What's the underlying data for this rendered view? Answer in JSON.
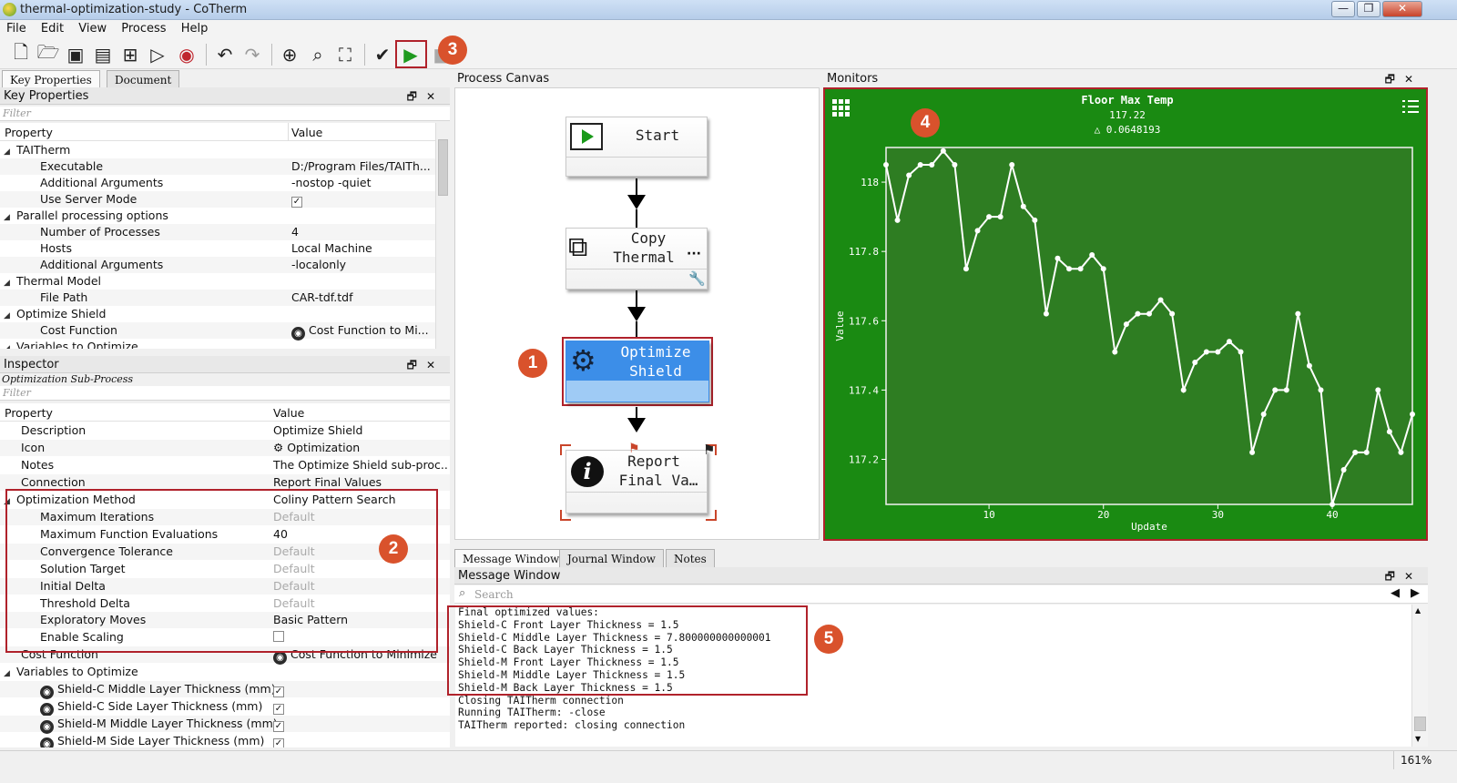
{
  "window": {
    "title": "thermal-optimization-study - CoTherm"
  },
  "menu": [
    "File",
    "Edit",
    "View",
    "Process",
    "Help"
  ],
  "colors": {
    "accent_red": "#b0222b",
    "badge": "#d9522c",
    "monitor_bg": "#1a8a12",
    "selected_node": "#3c8ee8"
  },
  "left_tabs": [
    "Key Properties",
    "Document"
  ],
  "key_properties": {
    "title": "Key Properties",
    "filter_placeholder": "Filter",
    "headers": {
      "property": "Property",
      "value": "Value"
    },
    "rows": [
      {
        "label": "TAITherm",
        "value": "",
        "level": 0,
        "group": true
      },
      {
        "label": "Executable",
        "value": "D:/Program Files/TAITh...",
        "level": 1
      },
      {
        "label": "Additional Arguments",
        "value": "-nostop -quiet",
        "level": 1
      },
      {
        "label": "Use Server Mode",
        "value": "✓",
        "level": 1,
        "checkbox": true
      },
      {
        "label": "Parallel processing options",
        "value": "",
        "level": 0,
        "group": true
      },
      {
        "label": "Number of Processes",
        "value": "4",
        "level": 1
      },
      {
        "label": "Hosts",
        "value": "Local Machine",
        "level": 1
      },
      {
        "label": "Additional Arguments",
        "value": "-localonly",
        "level": 1
      },
      {
        "label": "Thermal Model",
        "value": "",
        "level": 0,
        "group": true
      },
      {
        "label": "File Path",
        "value": "CAR-tdf.tdf",
        "level": 1
      },
      {
        "label": "Optimize Shield",
        "value": "",
        "level": 0,
        "group": true
      },
      {
        "label": "Cost Function",
        "value": "Cost Function to Mi...",
        "level": 1,
        "globe": true
      },
      {
        "label": "Variables to Optimize",
        "value": "",
        "level": 0,
        "group": true,
        "cut": true
      }
    ]
  },
  "inspector": {
    "title": "Inspector",
    "subtitle": "Optimization Sub-Process",
    "filter_placeholder": "Filter",
    "headers": {
      "property": "Property",
      "value": "Value"
    },
    "rows": [
      {
        "label": "Description",
        "value": "Optimize Shield",
        "level": 0
      },
      {
        "label": "Icon",
        "value": "Optimization",
        "level": 0,
        "gear": true
      },
      {
        "label": "Notes",
        "value": "The Optimize Shield sub-proc...",
        "level": 0
      },
      {
        "label": "Connection",
        "value": "Report Final Values",
        "level": 0
      },
      {
        "label": "Optimization Method",
        "value": "Coliny Pattern Search",
        "level": 0,
        "group": true
      },
      {
        "label": "Maximum Iterations",
        "value": "Default",
        "level": 1,
        "grey": true
      },
      {
        "label": "Maximum Function Evaluations",
        "value": "40",
        "level": 1
      },
      {
        "label": "Convergence Tolerance",
        "value": "Default",
        "level": 1,
        "grey": true
      },
      {
        "label": "Solution Target",
        "value": "Default",
        "level": 1,
        "grey": true
      },
      {
        "label": "Initial Delta",
        "value": "Default",
        "level": 1,
        "grey": true
      },
      {
        "label": "Threshold Delta",
        "value": "Default",
        "level": 1,
        "grey": true
      },
      {
        "label": "Exploratory Moves",
        "value": "Basic Pattern",
        "level": 1
      },
      {
        "label": "Enable Scaling",
        "value": "",
        "level": 1,
        "checkbox": true
      },
      {
        "label": "Cost Function",
        "value": "Cost Function to Minimize",
        "level": 0,
        "globe": true
      },
      {
        "label": "Variables to Optimize",
        "value": "",
        "level": 0,
        "group": true
      },
      {
        "label": "Shield-C Middle Layer Thickness (mm)",
        "value": "✓",
        "level": 1,
        "globe_label": true,
        "checkbox": true
      },
      {
        "label": "Shield-C Side Layer Thickness (mm)",
        "value": "✓",
        "level": 1,
        "globe_label": true,
        "checkbox": true
      },
      {
        "label": "Shield-M Middle Layer Thickness (mm)",
        "value": "✓",
        "level": 1,
        "globe_label": true,
        "checkbox": true
      },
      {
        "label": "Shield-M Side Layer Thickness (mm)",
        "value": "✓",
        "level": 1,
        "globe_label": true,
        "checkbox": true
      }
    ]
  },
  "canvas": {
    "title": "Process Canvas",
    "nodes": {
      "start": "Start",
      "copy_line1": "Copy",
      "copy_line2": "Thermal",
      "optimize_line1": "Optimize",
      "optimize_line2": "Shield",
      "report_line1": "Report",
      "report_line2": "Final Va…"
    }
  },
  "monitors": {
    "title": "Monitors",
    "menu_icon": "hamburger-icon",
    "grid_icon": "grid-icon"
  },
  "chart_data": {
    "type": "line",
    "title": "Floor Max Temp",
    "current_value": "117.22",
    "delta_label": "△ 0.0648193",
    "xlabel": "Update",
    "ylabel": "Value",
    "xlim": [
      1,
      47
    ],
    "ylim": [
      117.07,
      118.1
    ],
    "xticks": [
      10,
      20,
      30,
      40
    ],
    "yticks": [
      117.2,
      117.4,
      117.6,
      117.8,
      118
    ],
    "series": [
      {
        "x": [
          1,
          2,
          3,
          4,
          5,
          6,
          7,
          8,
          9,
          10,
          11,
          12,
          13,
          14,
          15,
          16,
          17,
          18,
          19,
          20,
          21,
          22,
          23,
          24,
          25,
          26,
          27,
          28,
          29,
          30,
          31,
          32,
          33,
          34,
          35,
          36,
          37,
          38,
          39,
          40,
          41,
          42,
          43,
          44,
          45,
          46,
          47
        ],
        "values": [
          118.05,
          117.89,
          118.02,
          118.05,
          118.05,
          118.09,
          118.05,
          117.75,
          117.86,
          117.9,
          117.9,
          118.05,
          117.93,
          117.89,
          117.62,
          117.78,
          117.75,
          117.75,
          117.79,
          117.75,
          117.51,
          117.59,
          117.62,
          117.62,
          117.66,
          117.62,
          117.4,
          117.48,
          117.51,
          117.51,
          117.54,
          117.51,
          117.22,
          117.33,
          117.4,
          117.4,
          117.62,
          117.47,
          117.4,
          117.07,
          117.17,
          117.22,
          117.22,
          117.4,
          117.28,
          117.22,
          117.33
        ]
      }
    ]
  },
  "bottom_tabs": [
    "Message Window",
    "Journal Window",
    "Notes"
  ],
  "message_window": {
    "title": "Message Window",
    "search_placeholder": "Search",
    "lines": [
      "Final optimized values:",
      "Shield-C Front Layer Thickness = 1.5",
      "Shield-C Middle Layer Thickness = 7.800000000000001",
      "Shield-C Back Layer Thickness = 1.5",
      "Shield-M Front Layer Thickness = 1.5",
      "Shield-M Middle Layer Thickness = 1.5",
      "Shield-M Back Layer Thickness = 1.5",
      "Closing TAITherm connection",
      "Running TAITherm: -close",
      "TAITherm reported: closing connection"
    ]
  },
  "annotations": [
    "1",
    "2",
    "3",
    "4",
    "5"
  ],
  "status": {
    "zoom": "161%"
  }
}
